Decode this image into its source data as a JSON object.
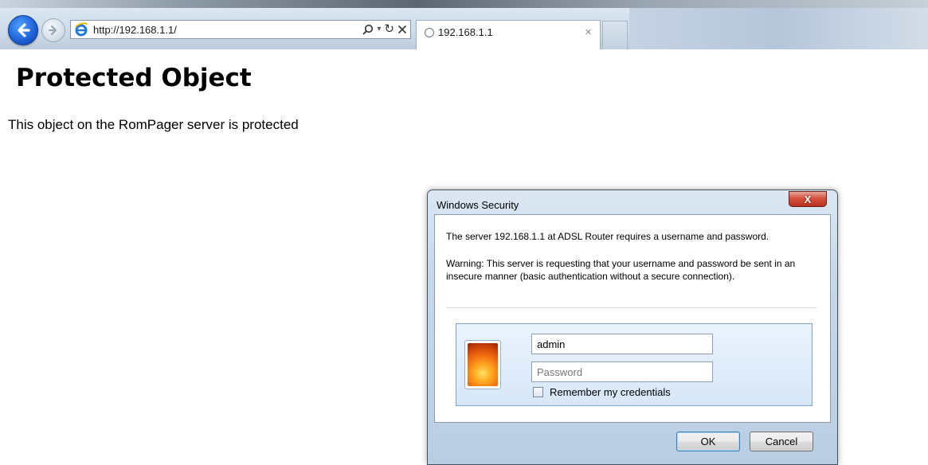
{
  "browser": {
    "address_url": "http://192.168.1.1/",
    "tab_title": "192.168.1.1",
    "tab_close": "×"
  },
  "page": {
    "heading": "Protected Object",
    "text": "This object on the RomPager server is protected"
  },
  "dialog": {
    "title": "Windows Security",
    "close_label": "X",
    "message": "The server 192.168.1.1 at ADSL Router requires a username and password.",
    "warning": "Warning: This server is requesting that your username and password be sent in an insecure manner (basic authentication without a secure connection).",
    "username_value": "admin",
    "password_placeholder": "Password",
    "remember_label": "Remember my credentials",
    "ok_label": "OK",
    "cancel_label": "Cancel"
  },
  "icons": [
    "back-arrow-icon",
    "forward-arrow-icon",
    "ie-logo-icon",
    "search-icon",
    "dropdown-icon",
    "refresh-icon",
    "stop-icon",
    "loading-icon",
    "user-tile-icon"
  ]
}
